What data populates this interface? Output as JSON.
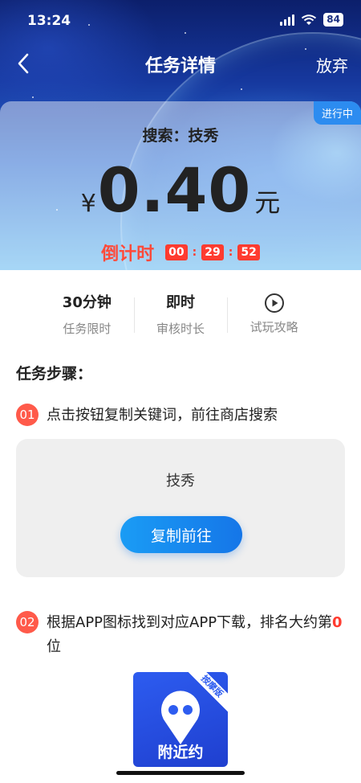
{
  "status_bar": {
    "time": "13:24",
    "battery": "84"
  },
  "nav": {
    "title": "任务详情",
    "giveup_label": "放弃"
  },
  "task_card": {
    "badge": "进行中",
    "search_label": "搜索：技秀",
    "currency_symbol": "¥",
    "amount": "0.40",
    "unit": "元",
    "countdown_label": "倒计时",
    "countdown": {
      "hours": "00",
      "minutes": "29",
      "seconds": "52"
    }
  },
  "stats": [
    {
      "value": "30分钟",
      "label": "任务限时"
    },
    {
      "value": "即时",
      "label": "审核时长"
    },
    {
      "icon": "play-circle-icon",
      "label": "试玩攻略"
    }
  ],
  "steps": {
    "title": "任务步骤：",
    "step1": {
      "num": "01",
      "text": "点击按钮复制关键词，前往商店搜索"
    },
    "keyword": "技秀",
    "copy_button": "复制前往",
    "step2": {
      "num": "02",
      "text_before": "根据APP图标找到对应APP下载，排名大约第",
      "rank": "0",
      "text_after": "位"
    }
  },
  "app_icon": {
    "ribbon": "按摩版",
    "name": "附近约"
  },
  "colors": {
    "accent_blue": "#1a8cf0",
    "accent_red": "#ff3b2f",
    "step_badge": "#ff5a4a"
  }
}
